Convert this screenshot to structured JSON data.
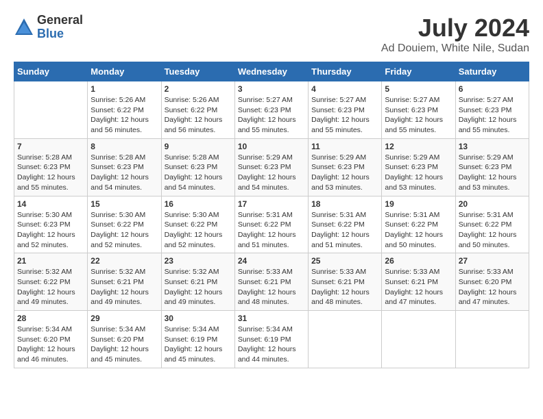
{
  "logo": {
    "general": "General",
    "blue": "Blue"
  },
  "title": "July 2024",
  "subtitle": "Ad Douiem, White Nile, Sudan",
  "days_of_week": [
    "Sunday",
    "Monday",
    "Tuesday",
    "Wednesday",
    "Thursday",
    "Friday",
    "Saturday"
  ],
  "weeks": [
    [
      {
        "day": "",
        "info": ""
      },
      {
        "day": "1",
        "info": "Sunrise: 5:26 AM\nSunset: 6:22 PM\nDaylight: 12 hours and 56 minutes."
      },
      {
        "day": "2",
        "info": "Sunrise: 5:26 AM\nSunset: 6:22 PM\nDaylight: 12 hours and 56 minutes."
      },
      {
        "day": "3",
        "info": "Sunrise: 5:27 AM\nSunset: 6:23 PM\nDaylight: 12 hours and 55 minutes."
      },
      {
        "day": "4",
        "info": "Sunrise: 5:27 AM\nSunset: 6:23 PM\nDaylight: 12 hours and 55 minutes."
      },
      {
        "day": "5",
        "info": "Sunrise: 5:27 AM\nSunset: 6:23 PM\nDaylight: 12 hours and 55 minutes."
      },
      {
        "day": "6",
        "info": "Sunrise: 5:27 AM\nSunset: 6:23 PM\nDaylight: 12 hours and 55 minutes."
      }
    ],
    [
      {
        "day": "7",
        "info": "Sunrise: 5:28 AM\nSunset: 6:23 PM\nDaylight: 12 hours and 55 minutes."
      },
      {
        "day": "8",
        "info": "Sunrise: 5:28 AM\nSunset: 6:23 PM\nDaylight: 12 hours and 54 minutes."
      },
      {
        "day": "9",
        "info": "Sunrise: 5:28 AM\nSunset: 6:23 PM\nDaylight: 12 hours and 54 minutes."
      },
      {
        "day": "10",
        "info": "Sunrise: 5:29 AM\nSunset: 6:23 PM\nDaylight: 12 hours and 54 minutes."
      },
      {
        "day": "11",
        "info": "Sunrise: 5:29 AM\nSunset: 6:23 PM\nDaylight: 12 hours and 53 minutes."
      },
      {
        "day": "12",
        "info": "Sunrise: 5:29 AM\nSunset: 6:23 PM\nDaylight: 12 hours and 53 minutes."
      },
      {
        "day": "13",
        "info": "Sunrise: 5:29 AM\nSunset: 6:23 PM\nDaylight: 12 hours and 53 minutes."
      }
    ],
    [
      {
        "day": "14",
        "info": "Sunrise: 5:30 AM\nSunset: 6:23 PM\nDaylight: 12 hours and 52 minutes."
      },
      {
        "day": "15",
        "info": "Sunrise: 5:30 AM\nSunset: 6:22 PM\nDaylight: 12 hours and 52 minutes."
      },
      {
        "day": "16",
        "info": "Sunrise: 5:30 AM\nSunset: 6:22 PM\nDaylight: 12 hours and 52 minutes."
      },
      {
        "day": "17",
        "info": "Sunrise: 5:31 AM\nSunset: 6:22 PM\nDaylight: 12 hours and 51 minutes."
      },
      {
        "day": "18",
        "info": "Sunrise: 5:31 AM\nSunset: 6:22 PM\nDaylight: 12 hours and 51 minutes."
      },
      {
        "day": "19",
        "info": "Sunrise: 5:31 AM\nSunset: 6:22 PM\nDaylight: 12 hours and 50 minutes."
      },
      {
        "day": "20",
        "info": "Sunrise: 5:31 AM\nSunset: 6:22 PM\nDaylight: 12 hours and 50 minutes."
      }
    ],
    [
      {
        "day": "21",
        "info": "Sunrise: 5:32 AM\nSunset: 6:22 PM\nDaylight: 12 hours and 49 minutes."
      },
      {
        "day": "22",
        "info": "Sunrise: 5:32 AM\nSunset: 6:21 PM\nDaylight: 12 hours and 49 minutes."
      },
      {
        "day": "23",
        "info": "Sunrise: 5:32 AM\nSunset: 6:21 PM\nDaylight: 12 hours and 49 minutes."
      },
      {
        "day": "24",
        "info": "Sunrise: 5:33 AM\nSunset: 6:21 PM\nDaylight: 12 hours and 48 minutes."
      },
      {
        "day": "25",
        "info": "Sunrise: 5:33 AM\nSunset: 6:21 PM\nDaylight: 12 hours and 48 minutes."
      },
      {
        "day": "26",
        "info": "Sunrise: 5:33 AM\nSunset: 6:21 PM\nDaylight: 12 hours and 47 minutes."
      },
      {
        "day": "27",
        "info": "Sunrise: 5:33 AM\nSunset: 6:20 PM\nDaylight: 12 hours and 47 minutes."
      }
    ],
    [
      {
        "day": "28",
        "info": "Sunrise: 5:34 AM\nSunset: 6:20 PM\nDaylight: 12 hours and 46 minutes."
      },
      {
        "day": "29",
        "info": "Sunrise: 5:34 AM\nSunset: 6:20 PM\nDaylight: 12 hours and 45 minutes."
      },
      {
        "day": "30",
        "info": "Sunrise: 5:34 AM\nSunset: 6:19 PM\nDaylight: 12 hours and 45 minutes."
      },
      {
        "day": "31",
        "info": "Sunrise: 5:34 AM\nSunset: 6:19 PM\nDaylight: 12 hours and 44 minutes."
      },
      {
        "day": "",
        "info": ""
      },
      {
        "day": "",
        "info": ""
      },
      {
        "day": "",
        "info": ""
      }
    ]
  ]
}
